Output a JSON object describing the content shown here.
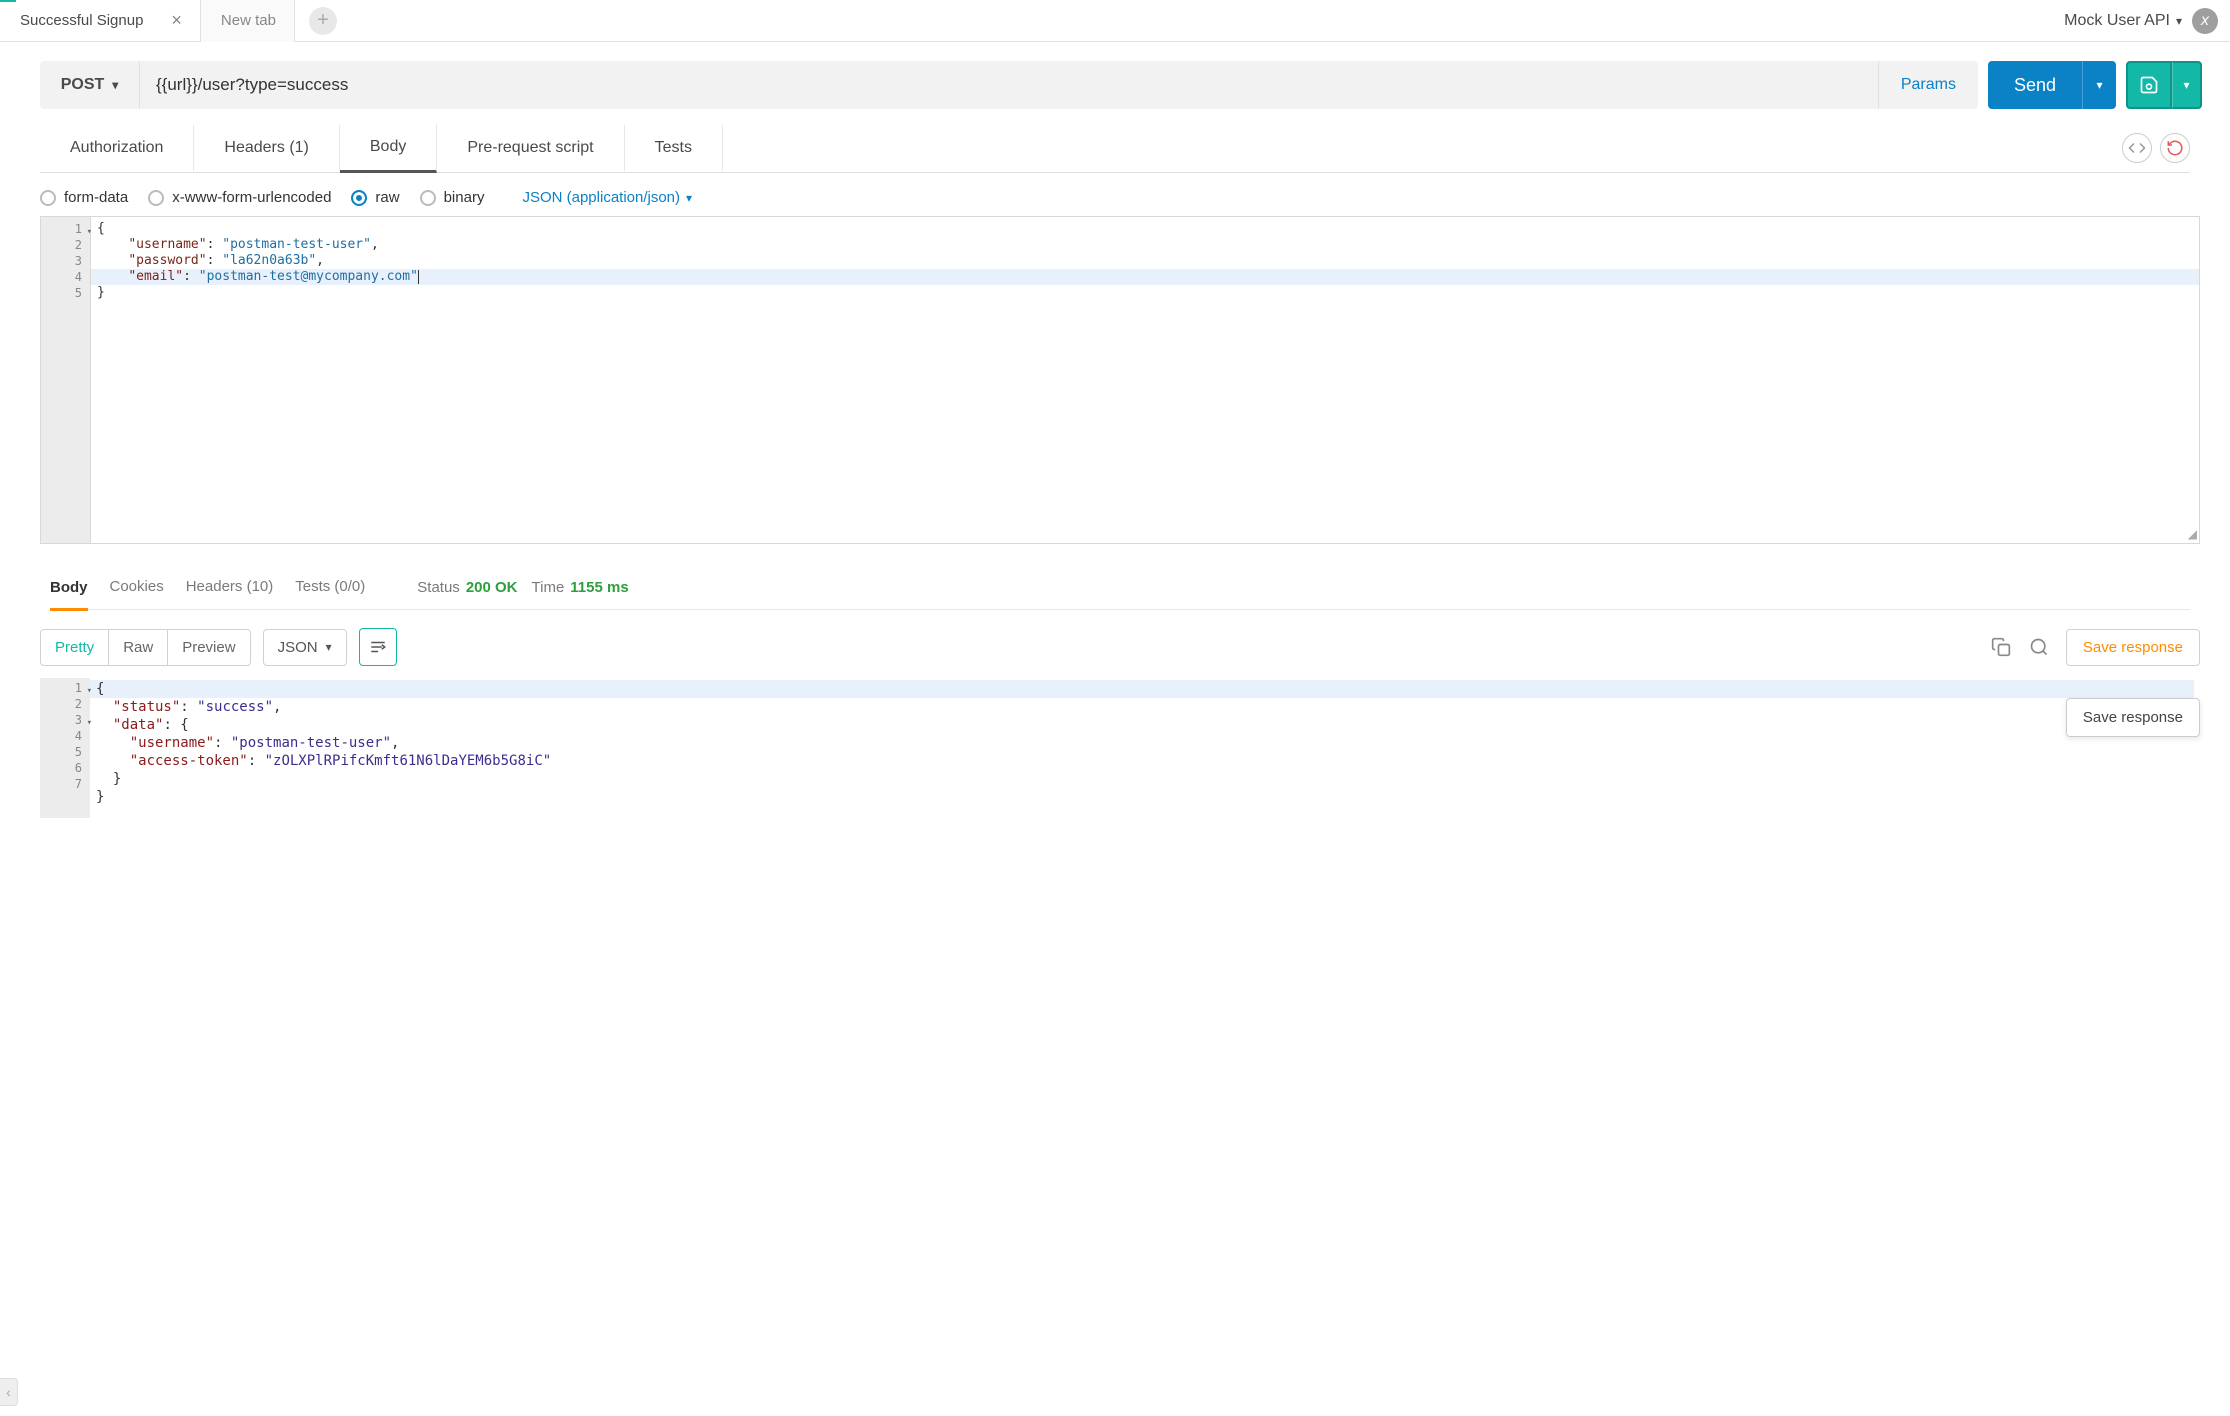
{
  "tabs": {
    "active": "Successful Signup",
    "new": "New tab"
  },
  "environment": "Mock User API",
  "request": {
    "method": "POST",
    "url": "{{url}}/user?type=success",
    "params_label": "Params",
    "send_label": "Send"
  },
  "req_tabs": {
    "auth": "Authorization",
    "headers": "Headers (1)",
    "body": "Body",
    "prereq": "Pre-request script",
    "tests": "Tests"
  },
  "body_types": {
    "formdata": "form-data",
    "urlencoded": "x-www-form-urlencoded",
    "raw": "raw",
    "binary": "binary",
    "content_type": "JSON (application/json)"
  },
  "req_body": {
    "l1": "{",
    "l2_indent": "    ",
    "l2_key": "\"username\"",
    "l2_colon": ": ",
    "l2_val": "\"postman-test-user\"",
    "l2_comma": ",",
    "l3_key": "\"password\"",
    "l3_val": "\"la62n0a63b\"",
    "l4_key": "\"email\"",
    "l4_val": "\"postman-test@mycompany.com\"",
    "l5": "}"
  },
  "resp_tabs": {
    "body": "Body",
    "cookies": "Cookies",
    "headers": "Headers (10)",
    "tests": "Tests (0/0)"
  },
  "resp_status": {
    "status_label": "Status",
    "status_value": "200 OK",
    "time_label": "Time",
    "time_value": "1155 ms"
  },
  "resp_views": {
    "pretty": "Pretty",
    "raw": "Raw",
    "preview": "Preview",
    "format": "JSON",
    "save": "Save response"
  },
  "resp_body": {
    "l1": "{",
    "l2_key": "\"status\"",
    "l2_val": "\"success\"",
    "l3_key": "\"data\"",
    "l3_val": "{",
    "l4_key": "\"username\"",
    "l4_val": "\"postman-test-user\"",
    "l5_key": "\"access-token\"",
    "l5_val": "\"zOLXPlRPifcKmft61N6lDaYEM6b5G8iC\"",
    "l6": "}",
    "l7": "}"
  },
  "tooltip": "Save response",
  "line_numbers": {
    "n1": "1",
    "n2": "2",
    "n3": "3",
    "n4": "4",
    "n5": "5",
    "n6": "6",
    "n7": "7"
  }
}
